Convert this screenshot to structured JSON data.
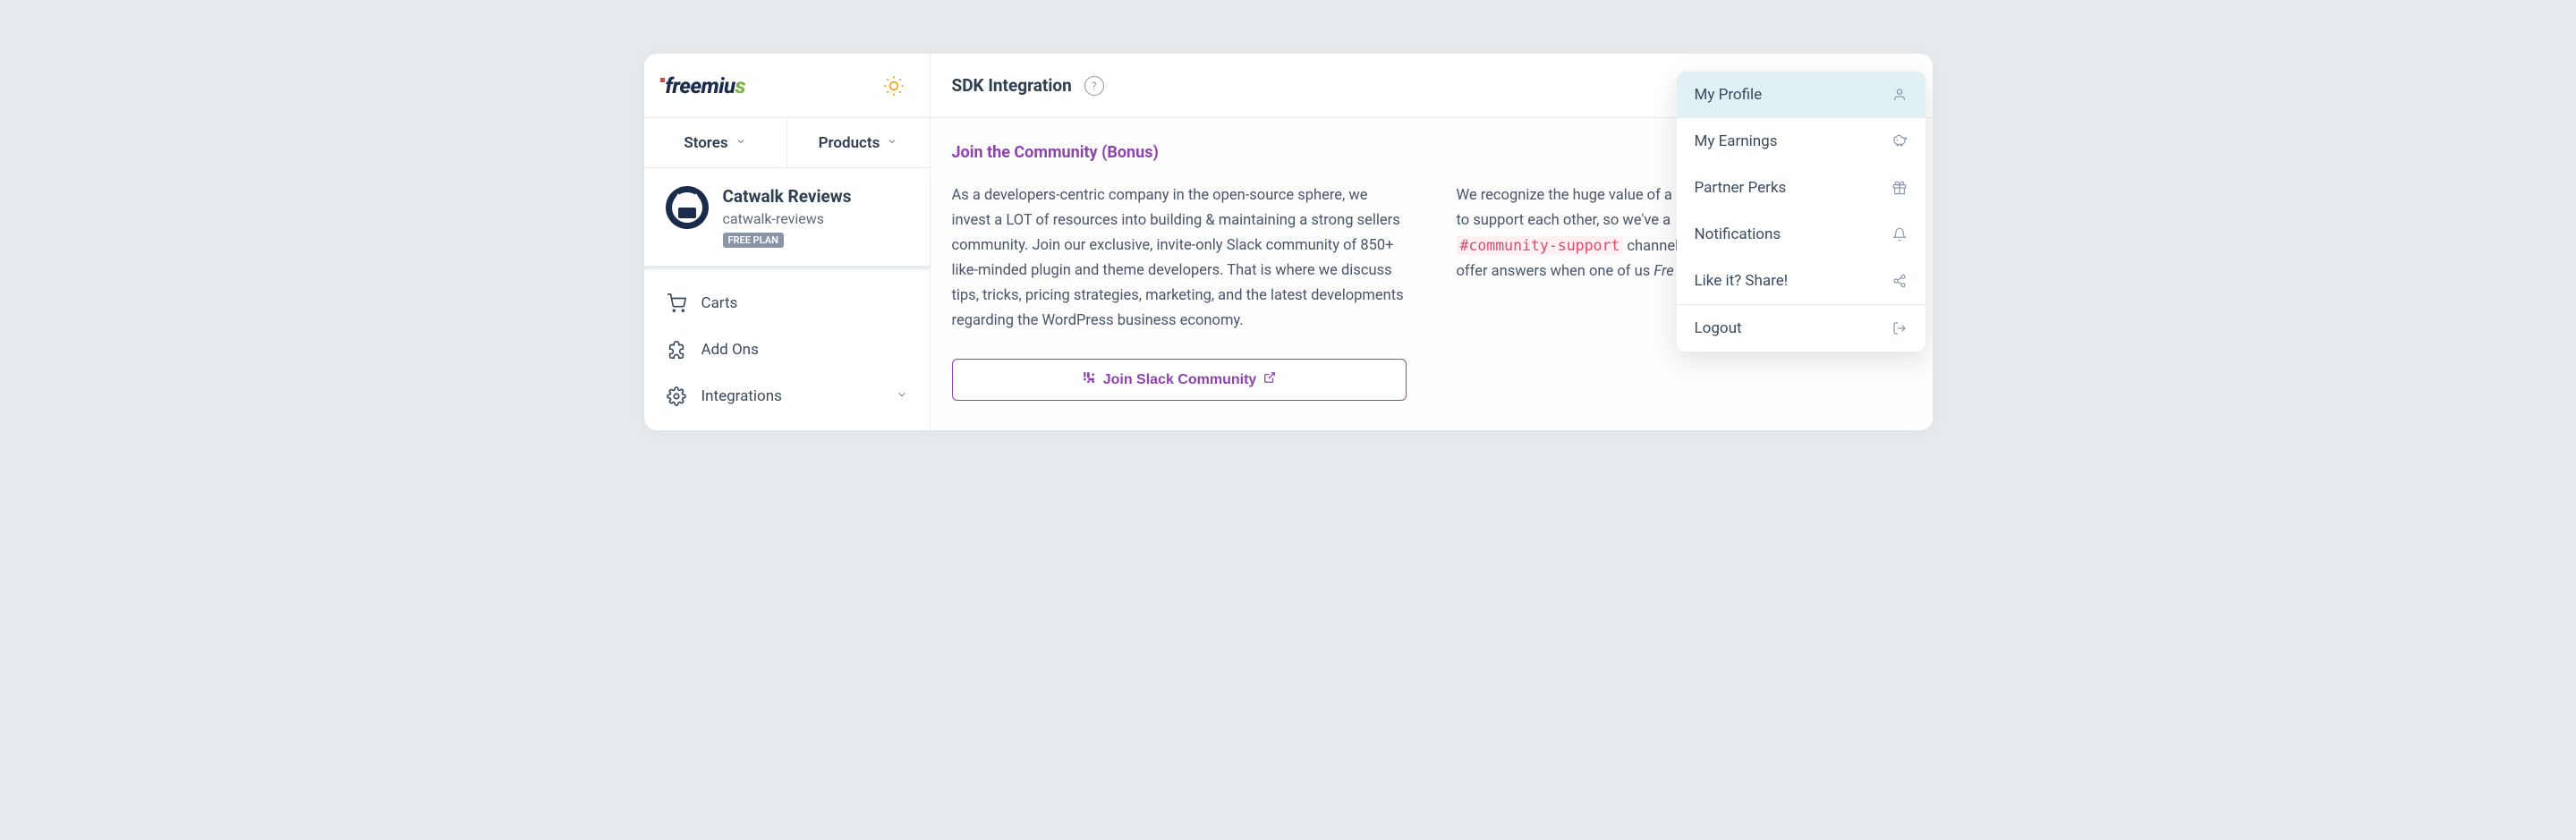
{
  "brand": {
    "name": "freemius"
  },
  "header": {
    "page_title": "SDK Integration"
  },
  "tabs": {
    "stores": "Stores",
    "products": "Products"
  },
  "product": {
    "name": "Catwalk Reviews",
    "slug": "catwalk-reviews",
    "plan_badge": "FREE PLAN"
  },
  "nav": {
    "carts": "Carts",
    "addons": "Add Ons",
    "integrations": "Integrations"
  },
  "main": {
    "section_title": "Join the Community (Bonus)",
    "column1": "As a developers-centric company in the open-source sphere, we invest a LOT of resources into building & maintaining a strong sellers community. Join our exclusive, invite-only Slack community of 850+ like-minded plugin and theme developers. That is where we discuss tips, tricks, pricing strategies, marketing, and the latest developments regarding the WordPress business economy.",
    "column2_part1": "We recognize the huge value of a",
    "column2_part2": "to support each other, so we've a",
    "community_channel": "#community-support",
    "column2_part3": " channel th",
    "column2_part4": "offer answers when one of us ",
    "column2_italic": "Fre",
    "cta_label": "Join Slack Community"
  },
  "user_menu": {
    "profile": "My Profile",
    "earnings": "My Earnings",
    "perks": "Partner Perks",
    "notifications": "Notifications",
    "share": "Like it? Share!",
    "logout": "Logout"
  }
}
